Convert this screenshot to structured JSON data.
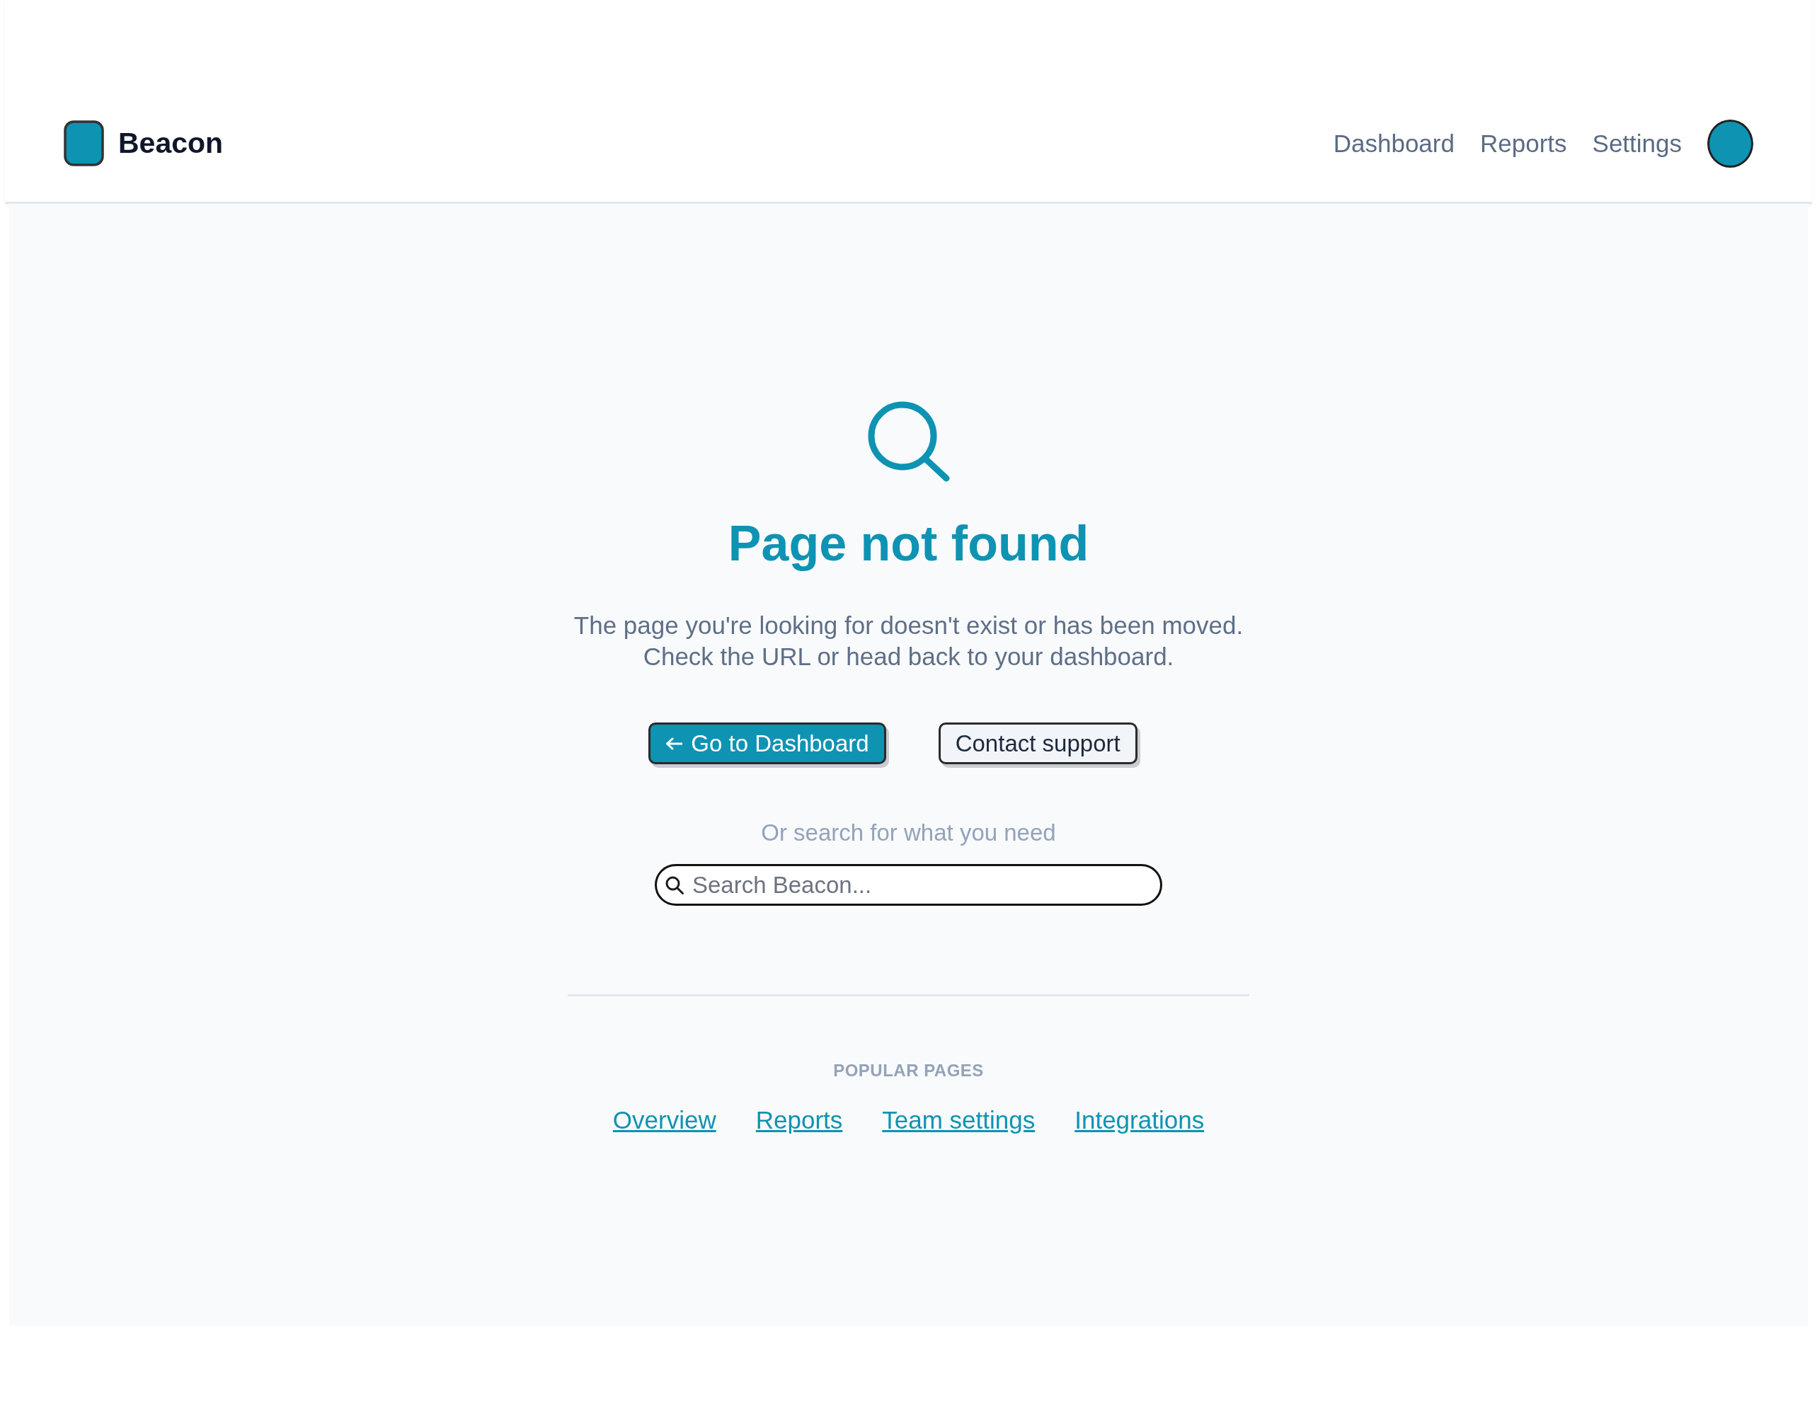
{
  "header": {
    "logo": {
      "name": "Beacon"
    },
    "nav": [
      {
        "label": "Dashboard"
      },
      {
        "label": "Reports"
      },
      {
        "label": "Settings"
      }
    ]
  },
  "error": {
    "title": "Page not found",
    "message": [
      "The page you're looking for doesn't exist or has been moved.",
      "Check the URL or head back to your dashboard."
    ],
    "actions": [
      {
        "kind": "primary",
        "label": "Go to Dashboard"
      },
      {
        "kind": "secondary",
        "label": "Contact support"
      }
    ]
  },
  "search": {
    "prompt": "Or search for what you need",
    "placeholder": "Search Beacon..."
  },
  "popular": {
    "heading": "POPULAR PAGES",
    "links": [
      "Overview",
      "Reports",
      "Team settings",
      "Integrations"
    ]
  }
}
